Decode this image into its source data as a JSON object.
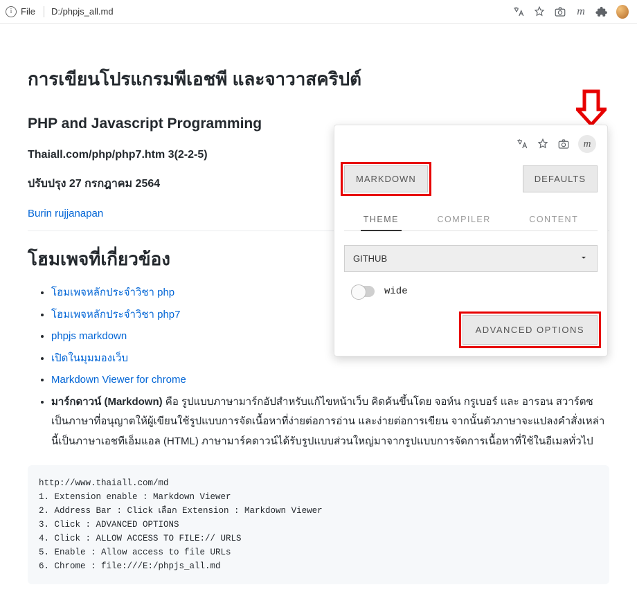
{
  "addressbar": {
    "scheme_label": "File",
    "path": "D:/phpjs_all.md"
  },
  "page": {
    "title_th": "การเขียนโปรแกรมพีเอชพี และจาวาสคริปต์",
    "title_en": "PHP and Javascript Programming",
    "source_line": "Thaiall.com/php/php7.htm 3(2-2-5)",
    "updated": "ปรับปรุง 27 กรกฎาคม 2564",
    "author_link": "Burin rujjanapan",
    "section_heading": "โฮมเพจที่เกี่ยวข้อง",
    "links": [
      "โฮมเพจหลักประจำวิชา php",
      "โฮมเพจหลักประจำวิชา php7",
      "phpjs markdown",
      "เปิดในมุมมองเว็บ",
      "Markdown Viewer for chrome"
    ],
    "markdown_desc_label": "มาร์กดาวน์ (Markdown)",
    "markdown_desc_rest": " คือ รูปแบบภาษามาร์กอัปสำหรับแก้ไขหน้าเว็บ คิดค้นขึ้นโดย จอห์น กรูเบอร์ และ อารอน สวาร์ตซ เป็นภาษาที่อนุญาตให้ผู้เขียนใช้รูปแบบการจัดเนื้อหาที่ง่ายต่อการอ่าน และง่ายต่อการเขียน จากนั้นตัวภาษาจะแปลงคำสั่งเหล่านี้เป็นภาษาเอชทีเอ็มแอล (HTML) ภาษามาร์คดาวน์ได้รับรูปแบบส่วนใหญ่มาจากรูปแบบการจัดการเนื้อหาที่ใช้ในอีเมลทั่วไป",
    "code": "http://www.thaiall.com/md\n1. Extension enable : Markdown Viewer\n2. Address Bar : Click เลือก Extension : Markdown Viewer\n3. Click : ADVANCED OPTIONS\n4. Click : ALLOW ACCESS TO FILE:// URLS\n5. Enable : Allow access to file URLs\n6. Chrome : file:///E:/phpjs_all.md"
  },
  "popup": {
    "markdown_btn": "MARKDOWN",
    "defaults_btn": "DEFAULTS",
    "tabs": {
      "theme": "THEME",
      "compiler": "COMPILER",
      "content": "CONTENT"
    },
    "select_value": "GITHUB",
    "wide_label": "wide",
    "advanced_btn": "ADVANCED OPTIONS"
  }
}
